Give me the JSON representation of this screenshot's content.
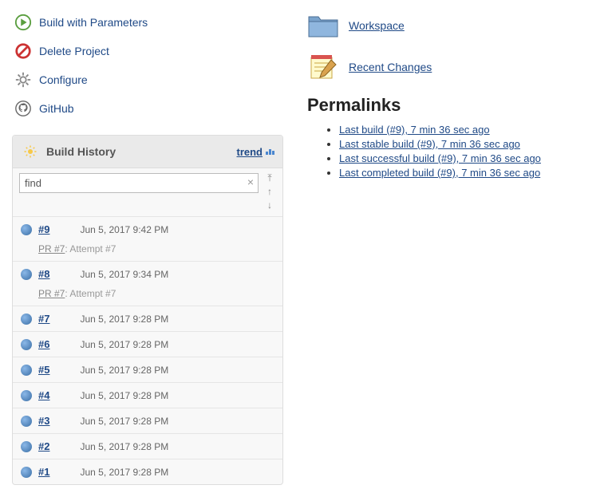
{
  "sidemenu": {
    "build_params": "Build with Parameters",
    "delete_project": "Delete Project",
    "configure": "Configure",
    "github": "GitHub"
  },
  "history": {
    "title": "Build History",
    "trend_label": "trend",
    "search_value": "find",
    "builds": [
      {
        "num": "#9",
        "time": "Jun 5, 2017 9:42 PM",
        "pr": "PR #7",
        "attempt": ": Attempt #7"
      },
      {
        "num": "#8",
        "time": "Jun 5, 2017 9:34 PM",
        "pr": "PR #7",
        "attempt": ": Attempt #7"
      },
      {
        "num": "#7",
        "time": "Jun 5, 2017 9:28 PM"
      },
      {
        "num": "#6",
        "time": "Jun 5, 2017 9:28 PM"
      },
      {
        "num": "#5",
        "time": "Jun 5, 2017 9:28 PM"
      },
      {
        "num": "#4",
        "time": "Jun 5, 2017 9:28 PM"
      },
      {
        "num": "#3",
        "time": "Jun 5, 2017 9:28 PM"
      },
      {
        "num": "#2",
        "time": "Jun 5, 2017 9:28 PM"
      },
      {
        "num": "#1",
        "time": "Jun 5, 2017 9:28 PM"
      }
    ]
  },
  "right": {
    "workspace": "Workspace",
    "recent_changes": "Recent Changes",
    "permalinks_heading": "Permalinks",
    "permalinks": [
      "Last build (#9), 7 min 36 sec ago",
      "Last stable build (#9), 7 min 36 sec ago",
      "Last successful build (#9), 7 min 36 sec ago",
      "Last completed build (#9), 7 min 36 sec ago"
    ]
  }
}
